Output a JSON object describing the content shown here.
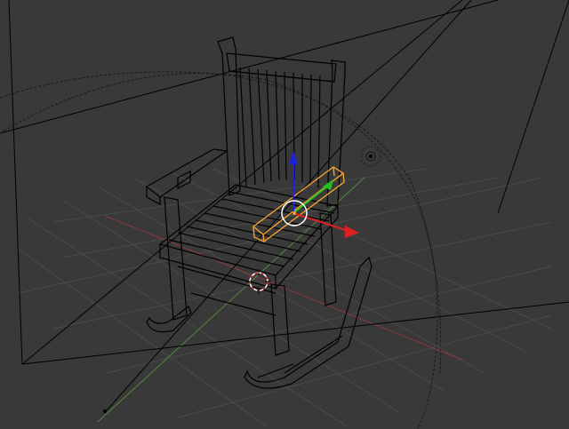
{
  "viewport": {
    "background": "#393939",
    "grid_color": "#4a4a4a",
    "x_axis_color": "#8a3a3a",
    "y_axis_color": "#4f8a3a",
    "wire_color": "#000000",
    "selection_color": "#f0a030",
    "gizmo_x_color": "#e02020",
    "gizmo_y_color": "#20c020",
    "gizmo_z_color": "#2020e0",
    "cursor_color": "#e03030"
  },
  "objects": {
    "chair_name": "rocking-chair",
    "selected_part": "arm-slat"
  },
  "icons": {
    "cursor": "3d-cursor-icon",
    "pivot": "pivot-circle-icon",
    "lamp": "lamp-icon"
  }
}
